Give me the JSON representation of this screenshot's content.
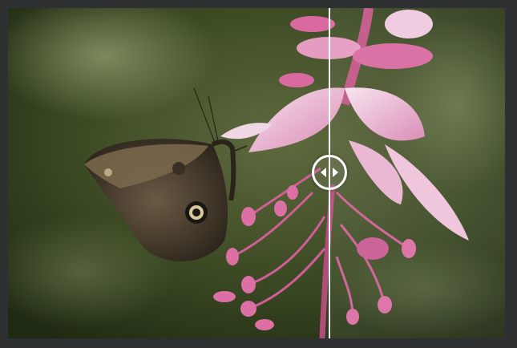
{
  "viewer": {
    "image_description_icon": "butterfly-on-pink-flower-photo",
    "slider_position_percent": 64.8
  },
  "handle": {
    "left_arrow_icon": "triangle-left-icon",
    "right_arrow_icon": "triangle-right-icon"
  },
  "colors": {
    "background": "#2f3032",
    "divider": "#ffffff",
    "flower_pink": "#e07fb0"
  }
}
